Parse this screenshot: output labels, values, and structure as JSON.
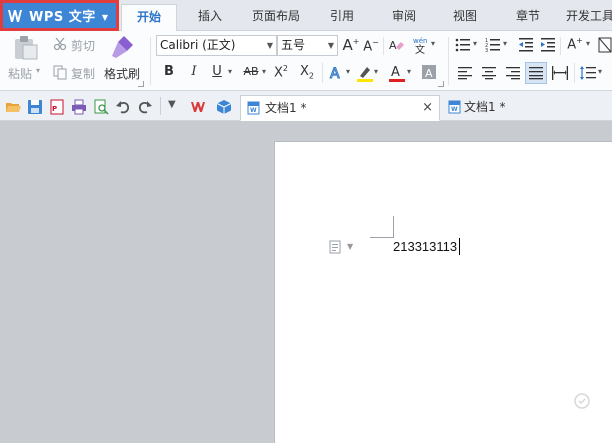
{
  "app": {
    "name": "WPS 文字",
    "accent_color": "#3d86d6",
    "highlight_border_color": "#e23d3d"
  },
  "menu_tabs": [
    {
      "label": "开始",
      "active": true
    },
    {
      "label": "插入",
      "active": false
    },
    {
      "label": "页面布局",
      "active": false
    },
    {
      "label": "引用",
      "active": false
    },
    {
      "label": "审阅",
      "active": false
    },
    {
      "label": "视图",
      "active": false
    },
    {
      "label": "章节",
      "active": false
    },
    {
      "label": "开发工具",
      "active": false
    }
  ],
  "ribbon": {
    "clipboard": {
      "paste": "粘贴",
      "cut": "剪切",
      "copy": "复制",
      "format_painter": "格式刷"
    },
    "font": {
      "family": "Calibri (正文)",
      "size": "五号"
    }
  },
  "quick_access_icons": [
    "open-folder-icon",
    "save-icon",
    "pdf-export-icon",
    "print-icon",
    "print-preview-icon",
    "undo-icon",
    "redo-icon",
    "customize-dropdown-icon",
    "wps-logo-icon",
    "cube-icon"
  ],
  "doc_tabs": [
    {
      "label": "文档1 *",
      "active": true
    },
    {
      "label": "文档1 *",
      "active": false
    }
  ],
  "document": {
    "text": "213313113"
  }
}
